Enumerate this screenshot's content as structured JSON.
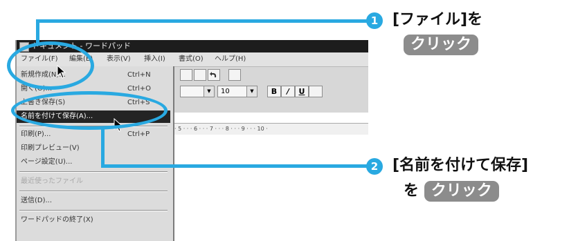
{
  "window": {
    "title": "ドキュメント - ワードパッド",
    "accent_color": "#29a9e1"
  },
  "menubar": {
    "items": [
      "ファイル(F)",
      "編集(E)",
      "表示(V)",
      "挿入(I)",
      "書式(O)",
      "ヘルプ(H)"
    ]
  },
  "file_menu": {
    "items": [
      {
        "label": "新規作成(N)...",
        "shortcut": "Ctrl+N"
      },
      {
        "label": "開く(O)...",
        "shortcut": "Ctrl+O"
      },
      {
        "label": "上書き保存(S)",
        "shortcut": "Ctrl+S"
      },
      {
        "label": "名前を付けて保存(A)...",
        "shortcut": ""
      },
      {
        "label": "印刷(P)...",
        "shortcut": "Ctrl+P"
      },
      {
        "label": "印刷プレビュー(V)",
        "shortcut": ""
      },
      {
        "label": "ページ設定(U)...",
        "shortcut": ""
      },
      {
        "label": "最近使ったファイル",
        "shortcut": ""
      },
      {
        "label": "送信(D)...",
        "shortcut": ""
      },
      {
        "label": "ワードパッドの終了(X)",
        "shortcut": ""
      }
    ],
    "highlighted_index": 3
  },
  "format_bar": {
    "font_size": "10",
    "bold_label": "B",
    "italic_label": "/",
    "underline_label": "U"
  },
  "ruler": {
    "text": "· 5 · · · 6 · · · 7 · · · 8 · · · 9 · · · 10 ·"
  },
  "callouts": {
    "step1": {
      "number": "1",
      "text": "[ファイル]を",
      "action": "クリック"
    },
    "step2": {
      "number": "2",
      "text": "[名前を付けて保存]",
      "text2": "を",
      "action": "クリック"
    }
  }
}
